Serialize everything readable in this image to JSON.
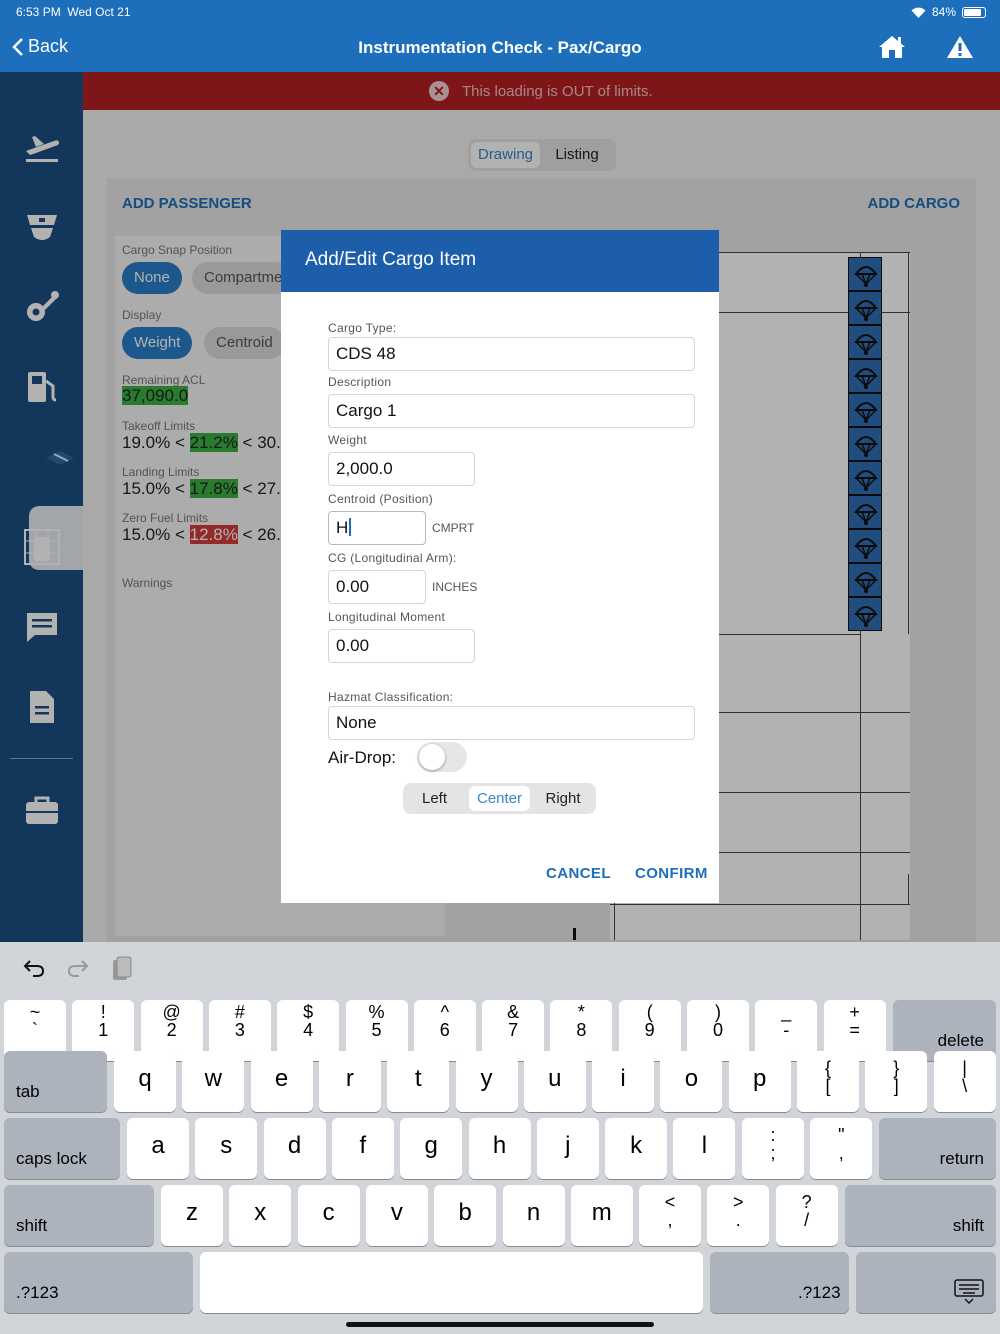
{
  "status": {
    "time": "6:53 PM",
    "date": "Wed Oct 21",
    "battery": "84%",
    "battery_level": 0.84
  },
  "nav": {
    "back": "Back",
    "title": "Instrumentation Check - Pax/Cargo",
    "icons": [
      "home-icon",
      "warning-icon"
    ]
  },
  "sidebar": {
    "items": [
      "departure-plane-icon",
      "pilot-cap-icon",
      "wrench-gear-icon",
      "fuel-pump-icon",
      "cargo-box-icon",
      "seat-grid-icon",
      "message-icon",
      "document-icon",
      "briefcase-icon"
    ],
    "active_index": 4
  },
  "banner": {
    "text": "This loading is OUT of limits."
  },
  "view_toggle": {
    "drawing": "Drawing",
    "listing": "Listing",
    "selected": "Drawing"
  },
  "panel": {
    "add_passenger": "ADD PASSENGER",
    "add_cargo": "ADD CARGO"
  },
  "info": {
    "snap_label": "Cargo Snap Position",
    "snap_none": "None",
    "snap_compartment": "Compartme",
    "display_label": "Display",
    "display_weight": "Weight",
    "display_centroid": "Centroid",
    "remaining_acl_label": "Remaining ACL",
    "remaining_acl": "37,090.0",
    "takeoff_label": "Takeoff Limits",
    "takeoff_low": "19.0%",
    "takeoff_val": "21.2%",
    "takeoff_high": "30.",
    "landing_label": "Landing Limits",
    "landing_low": "15.0%",
    "landing_val": "17.8%",
    "landing_high": "27.",
    "zerofuel_label": "Zero Fuel Limits",
    "zerofuel_low": "15.0%",
    "zerofuel_val": "12.8%",
    "zerofuel_high": "26.",
    "lt": "<",
    "warnings_label": "Warnings"
  },
  "dialog": {
    "title": "Add/Edit Cargo Item",
    "cargo_type_label": "Cargo Type:",
    "cargo_type": "CDS 48",
    "description_label": "Description",
    "description": "Cargo 1",
    "weight_label": "Weight",
    "weight": "2,000.0",
    "centroid_label": "Centroid (Position)",
    "centroid": "H",
    "centroid_unit": "CMPRT",
    "cg_label": "CG (Longitudinal Arm):",
    "cg": "0.00",
    "cg_unit": "INCHES",
    "moment_label": "Longitudinal Moment",
    "moment": "0.00",
    "hazmat_label": "Hazmat Classification:",
    "hazmat": "None",
    "airdrop_label": "Air-Drop:",
    "airdrop_on": false,
    "align_left": "Left",
    "align_center": "Center",
    "align_right": "Right",
    "align_selected": "Center",
    "cancel": "CANCEL",
    "confirm": "CONFIRM"
  },
  "keyboard": {
    "toolbar": [
      "undo-icon",
      "redo-icon",
      "paste-icon"
    ],
    "row1": [
      [
        "~",
        "`"
      ],
      [
        "!",
        "1"
      ],
      [
        "@",
        "2"
      ],
      [
        "#",
        "3"
      ],
      [
        "$",
        "4"
      ],
      [
        "%",
        "5"
      ],
      [
        "^",
        "6"
      ],
      [
        "&",
        "7"
      ],
      [
        "*",
        "8"
      ],
      [
        "(",
        "9"
      ],
      [
        ")",
        "0"
      ],
      [
        "_",
        "-"
      ],
      [
        "+",
        "="
      ]
    ],
    "delete": "delete",
    "tab": "tab",
    "row2": [
      "q",
      "w",
      "e",
      "r",
      "t",
      "y",
      "u",
      "i",
      "o",
      "p"
    ],
    "row2_sym": [
      [
        "{",
        "["
      ],
      [
        "}",
        "]"
      ],
      [
        "|",
        "\\"
      ]
    ],
    "caps": "caps lock",
    "row3": [
      "a",
      "s",
      "d",
      "f",
      "g",
      "h",
      "j",
      "k",
      "l"
    ],
    "row3_sym": [
      [
        ":",
        ";"
      ],
      [
        "\"",
        ","
      ]
    ],
    "return": "return",
    "shift": "shift",
    "row4": [
      "z",
      "x",
      "c",
      "v",
      "b",
      "n",
      "m"
    ],
    "row4_sym": [
      [
        "<",
        ","
      ],
      [
        ">",
        "."
      ],
      [
        "?",
        "/"
      ]
    ],
    "numbers": ".?123"
  }
}
